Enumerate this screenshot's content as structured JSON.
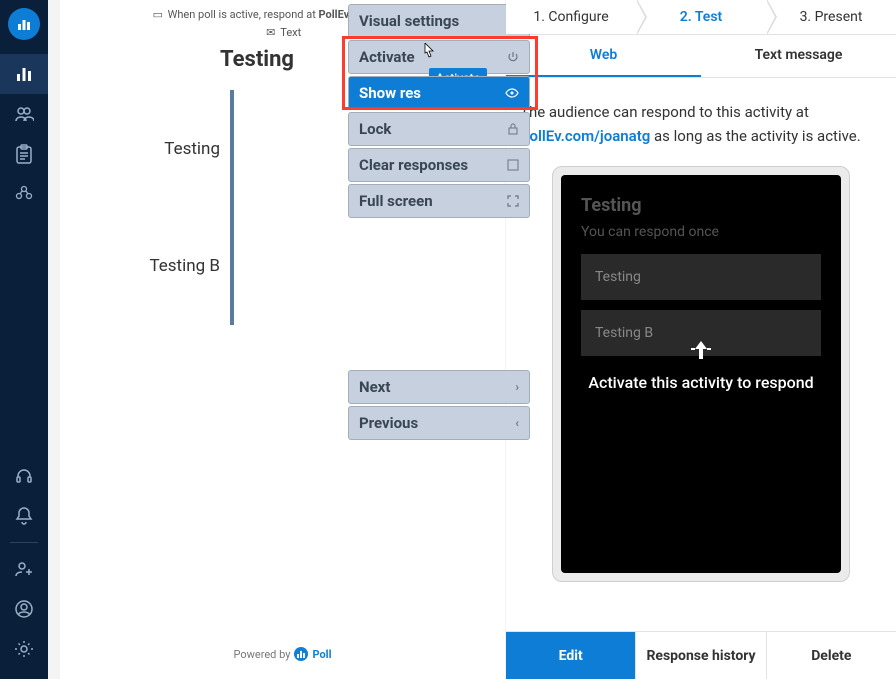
{
  "instructions": {
    "line1_prefix": "When poll is active, respond at ",
    "line1_url": "PollEv.com/joanatg",
    "line2": "Text"
  },
  "poll": {
    "title": "Testing",
    "options": [
      "Testing",
      "Testing B"
    ]
  },
  "powered": {
    "prefix": "Powered by",
    "brand": "Poll"
  },
  "menu": {
    "visual": "Visual settings",
    "activate": "Activate",
    "show": "Show res",
    "lock": "Lock",
    "clear": "Clear responses",
    "full": "Full screen",
    "next": "Next",
    "prev": "Previous",
    "tooltip": "Activate"
  },
  "steps": {
    "s1": "1. Configure",
    "s2": "2. Test",
    "s3": "3. Present"
  },
  "subtabs": {
    "web": "Web",
    "text": "Text message"
  },
  "info": {
    "before": "The audience can respond to this activity at ",
    "link": "PollEv.com/joanatg",
    "after": " as long as the activity is active."
  },
  "preview": {
    "title": "Testing",
    "sub": "You can respond once",
    "opt1": "Testing",
    "opt2": "Testing B",
    "overlay": "Activate this activity to respond"
  },
  "actions": {
    "edit": "Edit",
    "history": "Response history",
    "delete": "Delete"
  },
  "chart_data": {
    "type": "bar",
    "categories": [
      "Testing",
      "Testing B"
    ],
    "values": [
      0,
      0
    ],
    "title": "Testing",
    "xlabel": "",
    "ylabel": "",
    "ylim": [
      0,
      1
    ]
  }
}
